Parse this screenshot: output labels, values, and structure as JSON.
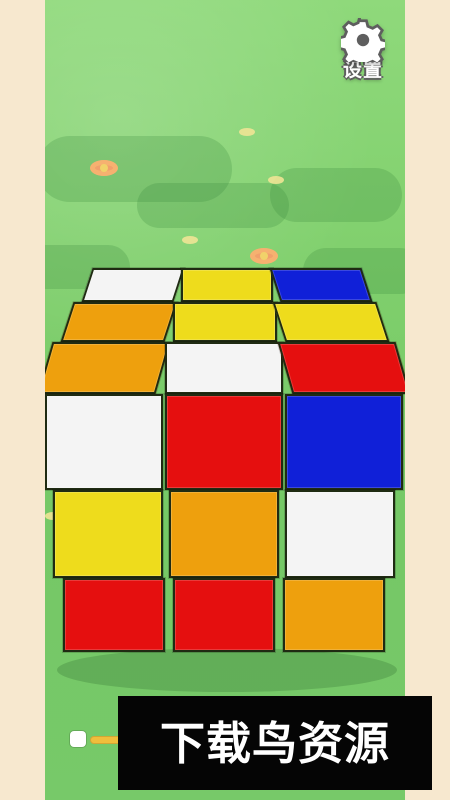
{
  "settings": {
    "label": "设置",
    "icon": "gear-icon"
  },
  "watermark": {
    "text": "下载鸟资源"
  },
  "cube": {
    "top_face": [
      [
        "white",
        "yellow",
        "blue"
      ],
      [
        "orange",
        "yellow",
        "yellow"
      ],
      [
        "orange",
        "white",
        "red"
      ]
    ],
    "front_face": [
      [
        "white",
        "red",
        "blue"
      ],
      [
        "yellow",
        "orange",
        "white"
      ],
      [
        "red",
        "red",
        "orange"
      ]
    ]
  },
  "colors": {
    "white": "#f4f4f4",
    "yellow": "#eedc1c",
    "blue": "#1020d8",
    "orange": "#eea00d",
    "red": "#e50f0f",
    "green": "#7fd06b",
    "watermark_bg": "#050505",
    "progress": "#f0be3c"
  }
}
